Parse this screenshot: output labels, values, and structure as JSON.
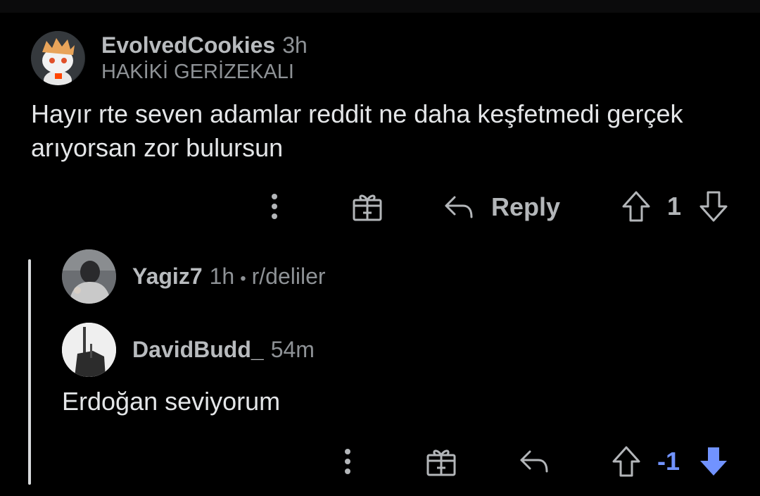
{
  "comment": {
    "username": "EvolvedCookies",
    "time": "3h",
    "flair": "HAKİKİ GERİZEKALI",
    "body": "Hayır rte seven adamlar reddit ne daha keşfetmedi gerçek arıyorsan zor bulursun",
    "actions": {
      "more_icon": "more-vertical-icon",
      "award_icon": "gift-icon",
      "reply_label": "Reply",
      "score": "1"
    }
  },
  "reply_parent": {
    "username": "Yagiz7",
    "time": "1h",
    "separator": "•",
    "subreddit": "r/deliler"
  },
  "reply": {
    "username": "DavidBudd_",
    "time": "54m",
    "body": "Erdoğan seviyorum",
    "actions": {
      "score": "-1",
      "downvoted": true
    }
  },
  "colors": {
    "background": "#000000",
    "text": "#e4e6e8",
    "muted": "#8e9296",
    "downvote": "#7193ff",
    "thread_line": "#d7dadc"
  }
}
